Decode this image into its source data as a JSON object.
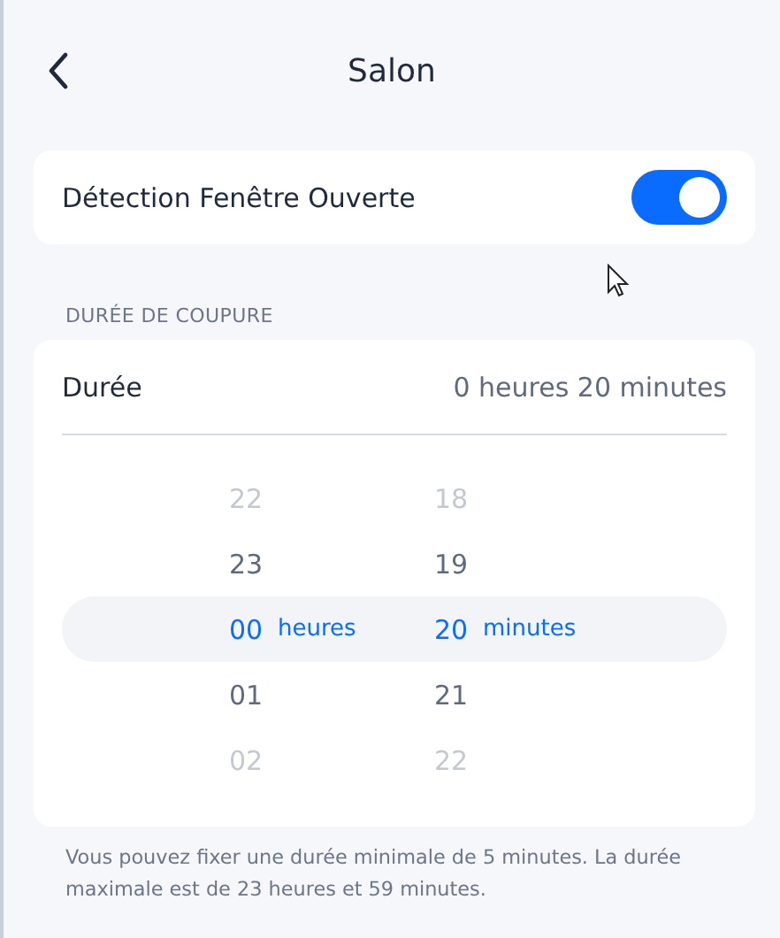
{
  "header": {
    "title": "Salon"
  },
  "window_detection": {
    "label": "Détection Fenêtre Ouverte",
    "on": true
  },
  "section_title": "DURÉE DE COUPURE",
  "duration": {
    "label": "Durée",
    "value": "0 heures 20 minutes"
  },
  "picker": {
    "hours_unit": "heures",
    "minutes_unit": "minutes",
    "rows": [
      {
        "hours": "22",
        "minutes": "18",
        "selected": false
      },
      {
        "hours": "23",
        "minutes": "19",
        "selected": false
      },
      {
        "hours": "00",
        "minutes": "20",
        "selected": true
      },
      {
        "hours": "01",
        "minutes": "21",
        "selected": false
      },
      {
        "hours": "02",
        "minutes": "22",
        "selected": false
      }
    ]
  },
  "footnote": "Vous pouvez fixer une durée minimale de 5 minutes. La durée maximale est de 23 heures et 59 minutes."
}
